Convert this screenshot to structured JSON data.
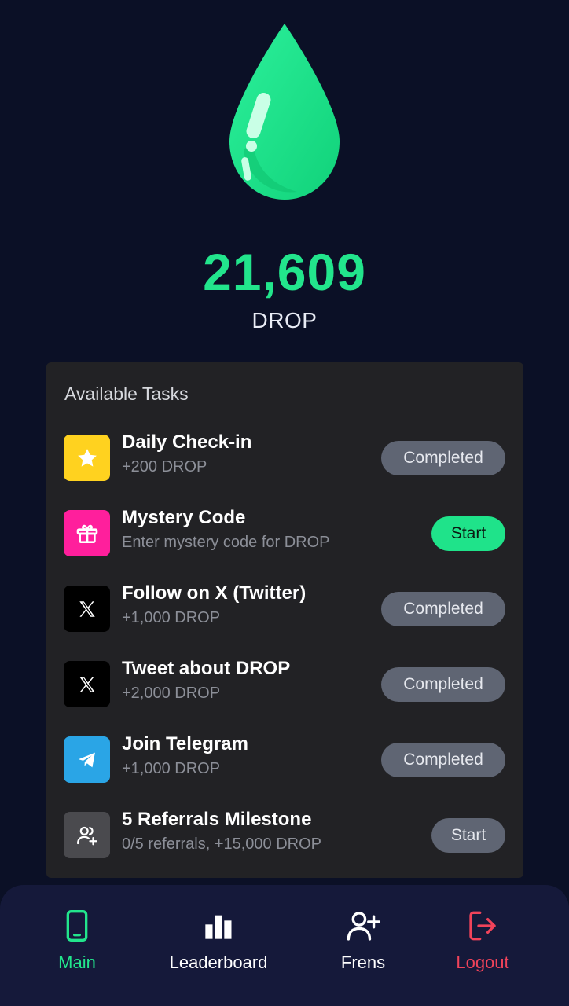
{
  "balance": {
    "amount": "21,609",
    "unit": "DROP"
  },
  "tasks_panel": {
    "title": "Available Tasks",
    "items": [
      {
        "title": "Daily Check-in",
        "subtitle": "+200 DROP",
        "action": "Completed",
        "icon": "star-icon",
        "icon_color": "#ffd21f"
      },
      {
        "title": "Mystery Code",
        "subtitle": "Enter mystery code for DROP",
        "action": "Start",
        "icon": "gift-icon",
        "icon_color": "#ff1f9c"
      },
      {
        "title": "Follow on X (Twitter)",
        "subtitle": "+1,000 DROP",
        "action": "Completed",
        "icon": "x-logo-icon",
        "icon_color": "#000000"
      },
      {
        "title": "Tweet about DROP",
        "subtitle": "+2,000 DROP",
        "action": "Completed",
        "icon": "x-logo-icon",
        "icon_color": "#000000"
      },
      {
        "title": "Join Telegram",
        "subtitle": "+1,000 DROP",
        "action": "Completed",
        "icon": "telegram-icon",
        "icon_color": "#2aa5e6"
      },
      {
        "title": "5 Referrals Milestone",
        "subtitle": "0/5 referrals, +15,000 DROP",
        "action": "Start",
        "icon": "users-plus-icon",
        "icon_color": "#4a4a4e"
      }
    ]
  },
  "nav": {
    "items": [
      {
        "label": "Main",
        "icon": "phone-icon",
        "color": "#22e58c"
      },
      {
        "label": "Leaderboard",
        "icon": "bar-chart-icon",
        "color": "#ffffff"
      },
      {
        "label": "Frens",
        "icon": "user-plus-icon",
        "color": "#ffffff"
      },
      {
        "label": "Logout",
        "icon": "logout-icon",
        "color": "#f0435a"
      }
    ]
  },
  "colors": {
    "background": "#0b1026",
    "accent_green": "#22e58c",
    "panel": "#222225",
    "logout_red": "#f0435a"
  }
}
